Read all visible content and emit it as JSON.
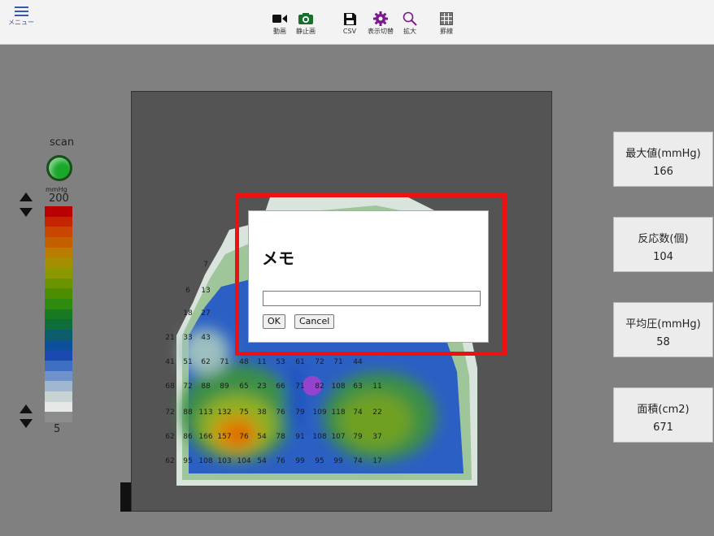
{
  "toolbar": {
    "menu_label": "メニュー",
    "buttons": [
      {
        "label": "動画",
        "icon": "video-camera-icon"
      },
      {
        "label": "静止画",
        "icon": "camera-icon"
      },
      {
        "label": "CSV",
        "icon": "save-icon"
      },
      {
        "label": "表示切替",
        "icon": "gear-icon"
      },
      {
        "label": "拡大",
        "icon": "magnifier-icon"
      },
      {
        "label": "罫線",
        "icon": "grid-icon"
      }
    ]
  },
  "scale": {
    "scan_label": "scan",
    "unit": "mmHg",
    "max": "200",
    "min": "5",
    "status_color": "#1aa82a"
  },
  "stats": [
    {
      "title": "最大値(mmHg)",
      "value": "166"
    },
    {
      "title": "反応数(個)",
      "value": "104"
    },
    {
      "title": "平均圧(mmHg)",
      "value": "58"
    },
    {
      "title": "面積(cm2)",
      "value": "671"
    }
  ],
  "heatmap_numbers": [
    {
      "row": 0,
      "values": [
        "7"
      ]
    },
    {
      "row": 1,
      "values": [
        "6",
        "13"
      ]
    },
    {
      "row": 2,
      "values": [
        "18",
        "27"
      ]
    },
    {
      "row": 3,
      "values": [
        "21",
        "33",
        "43"
      ]
    },
    {
      "row": 4,
      "values": [
        "41",
        "51",
        "62",
        "71",
        "48",
        "11",
        "53",
        "61",
        "72",
        "71",
        "44"
      ]
    },
    {
      "row": 5,
      "values": [
        "68",
        "72",
        "88",
        "89",
        "65",
        "23",
        "66",
        "71",
        "82",
        "108",
        "63",
        "11"
      ]
    },
    {
      "row": 6,
      "values": [
        "72",
        "88",
        "113",
        "132",
        "75",
        "38",
        "76",
        "79",
        "109",
        "118",
        "74",
        "22"
      ]
    },
    {
      "row": 7,
      "values": [
        "62",
        "86",
        "166",
        "157",
        "76",
        "54",
        "78",
        "91",
        "108",
        "107",
        "79",
        "37"
      ]
    },
    {
      "row": 8,
      "values": [
        "62",
        "95",
        "108",
        "103",
        "104",
        "54",
        "76",
        "99",
        "95",
        "99",
        "74",
        "17"
      ]
    }
  ],
  "dialog": {
    "title": "メモ",
    "input_value": "",
    "ok_label": "OK",
    "cancel_label": "Cancel"
  },
  "colors": {
    "highlight_frame": "#ee1111",
    "scale_colors": [
      "#b80000",
      "#c52400",
      "#c84600",
      "#c45f00",
      "#b87c00",
      "#a48f00",
      "#8c9800",
      "#6b9500",
      "#4c8e00",
      "#2f8a10",
      "#177a22",
      "#0e6e3a",
      "#0b5d6b",
      "#0c4f9b",
      "#1a49b0",
      "#3f6fc0",
      "#6e92c9",
      "#9fb8cf",
      "#c7d3d2",
      "#e5e8e6",
      "#8c8c8c"
    ]
  }
}
